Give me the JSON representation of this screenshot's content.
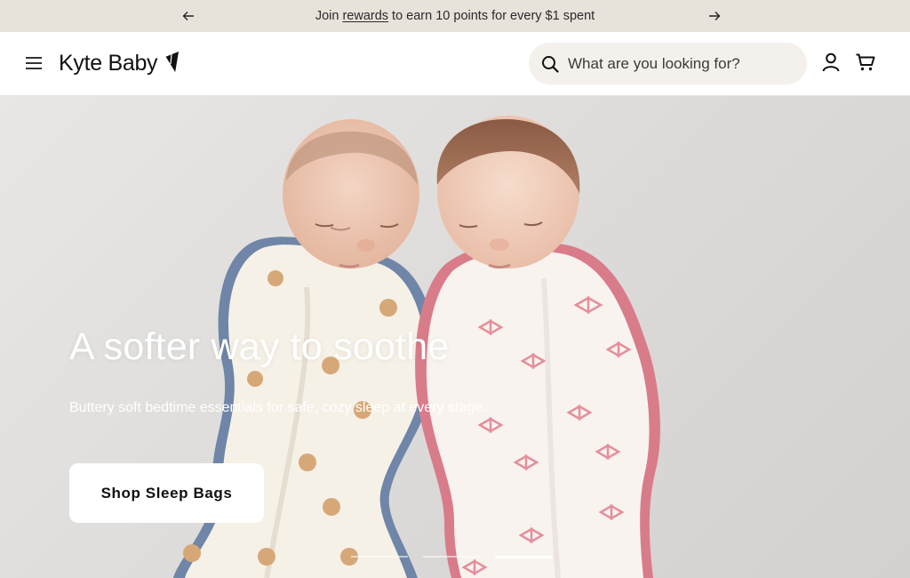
{
  "announcement": {
    "prefix": "Join ",
    "link": "rewards",
    "suffix": " to earn 10 points for every $1 spent",
    "prev_icon": "arrow-left-icon",
    "next_icon": "arrow-right-icon"
  },
  "header": {
    "logo_text": "Kyte Baby",
    "search_placeholder": "What are you looking for?",
    "icons": [
      "menu-icon",
      "search-icon",
      "account-icon",
      "cart-icon"
    ]
  },
  "hero": {
    "title": "A softer way to soothe",
    "subtitle": "Buttery soft bedtime essentials for safe, cozy sleep at every stage.",
    "cta": "Shop Sleep Bags",
    "slides": 3,
    "active_slide": 3
  },
  "colors": {
    "announcement_bg": "#e8e3da",
    "search_bg": "#f4f1ec",
    "hero_bg": "#dedcda",
    "trim_blue": "#6f86a8",
    "trim_pink": "#d97c8a"
  }
}
